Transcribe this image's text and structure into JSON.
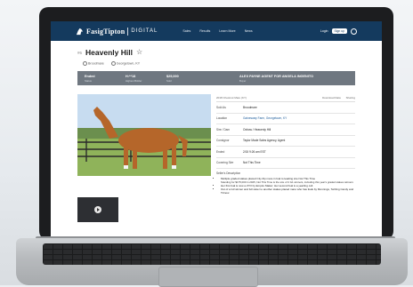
{
  "site": {
    "brand": "FasigTipton",
    "brand_suffix": "DIGITAL",
    "nav_links": [
      "Sales",
      "Results",
      "Learn More",
      "News"
    ],
    "login_label": "Login",
    "signup_label": "Sign up"
  },
  "listing": {
    "hip": "#6",
    "name": "Heavenly Hill",
    "meta": [
      "Broodmare",
      "Georgetown, KY"
    ],
    "stats": [
      {
        "value": "Ended",
        "key": "Status"
      },
      {
        "value": "H:**18",
        "key": "Highest Bidder"
      },
      {
        "value": "$25,000",
        "key": "Sold"
      }
    ],
    "agent_value": "ALEX PAYNE AGENT FOR ANGELA INGENITO",
    "agent_key": "Buyer"
  },
  "details": {
    "header_left": "2018 Chestnut Mare (KY)",
    "header_actions": [
      "Download Data",
      "Sharing"
    ],
    "rows": [
      {
        "key": "Sold As",
        "value": "Broodmare",
        "link": false
      },
      {
        "key": "Location",
        "value": "Gainesway Farm, Georgetown, KY",
        "link": true
      },
      {
        "key": "Sire / Dam",
        "value": "Oxbow / Heavenly Hill",
        "link": false
      },
      {
        "key": "Consignor",
        "value": "Taylor Made Sales Agency, Agent",
        "link": false
      },
      {
        "key": "Ended",
        "value": "2/15 9:26 am EST",
        "link": false
      },
      {
        "key": "Covering Sire",
        "value": "Not This Time",
        "link": false
      }
    ],
    "description_title": "Seller's Description",
    "description_items": [
      {
        "text": "Multiple graded stakes placed City Zip mare in foal to leading sire Not This Time",
        "sub": "Standing for $175,000 in 2025, Not This Time is the sire of 4 G1 winners, including this year's graded stakes winners"
      },
      {
        "text": "Her first foal is now a 2YO by Empire Maker; Her second foal is a yearling colt",
        "sub": ""
      },
      {
        "text": "Out of a G3 winner and full sister to another stakes placed mare who has foals by Munnings, Twirling Candy and Tiznow",
        "sub": ""
      }
    ]
  },
  "colors": {
    "nav": "#143a5e",
    "status_bar": "#6f7780",
    "link": "#1e5d9c"
  }
}
